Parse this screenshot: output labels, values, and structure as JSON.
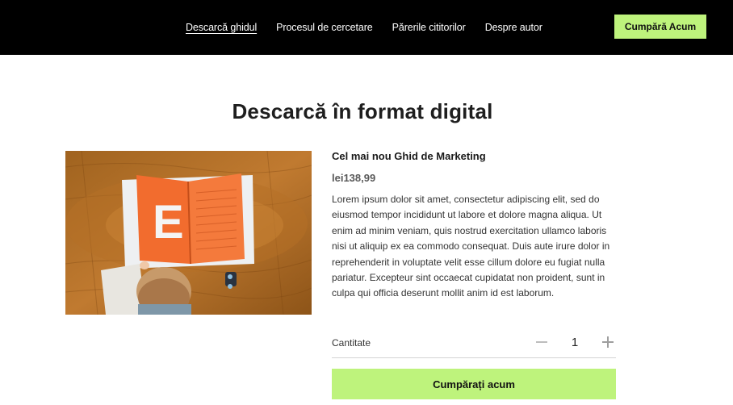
{
  "nav": {
    "items": [
      {
        "label": "Descarcă ghidul",
        "active": true
      },
      {
        "label": "Procesul de cercetare",
        "active": false
      },
      {
        "label": "Părerile cititorilor",
        "active": false
      },
      {
        "label": "Despre autor",
        "active": false
      }
    ],
    "cta_label": "Cumpără Acum"
  },
  "main": {
    "title": "Descarcă în format digital",
    "product": {
      "name": "Cel mai nou Ghid de Marketing",
      "price": "lei138,99",
      "description": "Lorem ipsum dolor sit amet, consectetur adipiscing elit, sed do eiusmod tempor incididunt ut labore et dolore magna ali­qua. Ut enim ad minim veniam, quis nostrud exercitation ul­lamco laboris nisi ut aliquip ex ea commodo consequat. Duis aute irure dolor in reprehenderit in voluptate velit esse cillum dolore eu fugiat nulla pariatur. Excepteur sint occaecat cupi­datat non proident, sunt in culpa qui officia deserunt mollit anim id est laborum.",
      "image_letter": "E"
    },
    "quantity": {
      "label": "Cantitate",
      "value": "1"
    },
    "buy_label": "Cumpărați acum"
  },
  "colors": {
    "accent": "#bef37c",
    "header_bg": "#000000"
  },
  "icons": {
    "decrease": "minus-icon",
    "increase": "plus-icon"
  }
}
